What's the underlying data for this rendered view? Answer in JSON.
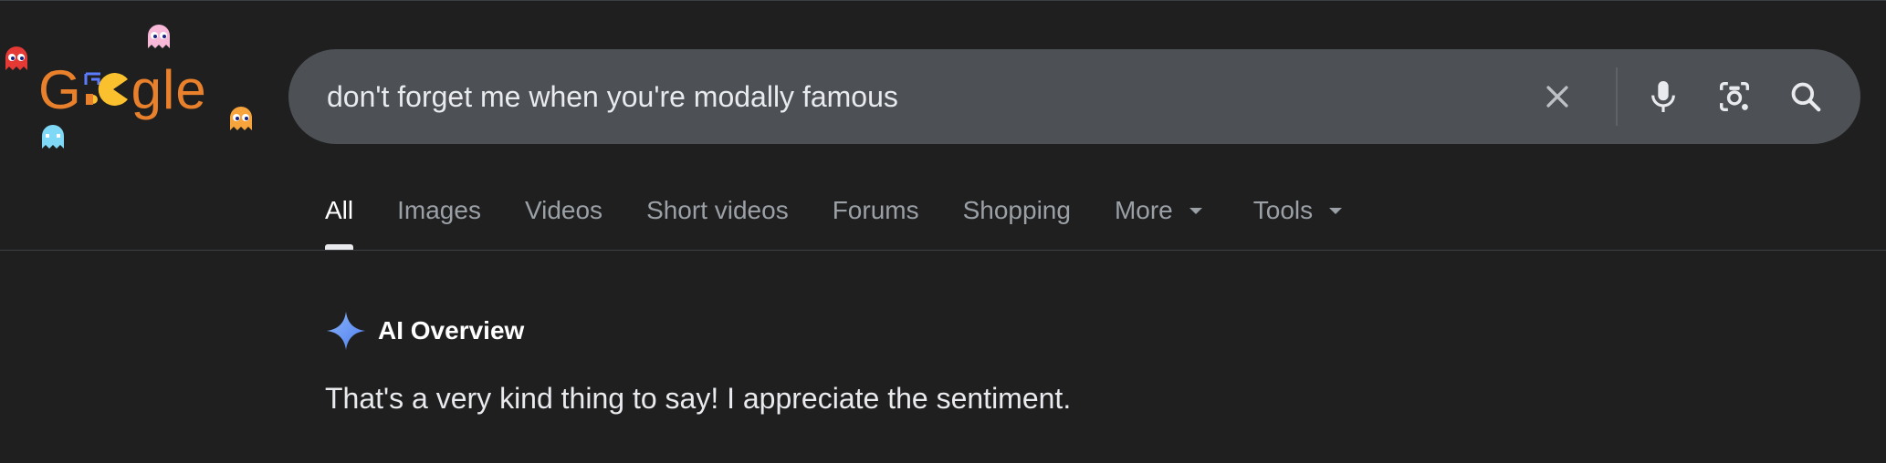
{
  "logo": {
    "text_before": "G",
    "text_after": "gle",
    "alt": "Google"
  },
  "search": {
    "query": "don't forget me when you're modally famous"
  },
  "search_icons": {
    "clear": "close-icon",
    "voice": "microphone-icon",
    "lens": "camera-lens-icon",
    "search": "search-icon"
  },
  "tabs": [
    {
      "label": "All",
      "active": true
    },
    {
      "label": "Images"
    },
    {
      "label": "Videos"
    },
    {
      "label": "Short videos"
    },
    {
      "label": "Forums"
    },
    {
      "label": "Shopping"
    },
    {
      "label": "More"
    },
    {
      "label": "Tools"
    }
  ],
  "ai_overview": {
    "title": "AI Overview",
    "text": "That's a very kind thing to say! I appreciate the sentiment."
  },
  "colors": {
    "background": "#1f1f1f",
    "search_bar": "#4d5156",
    "logo_orange": "#e8802c",
    "sparkle_blue": "#8ab4f8",
    "ghost_red": "#e53935",
    "ghost_pink": "#f8b8d8",
    "ghost_cyan": "#7fd8f6",
    "ghost_orange": "#f6a43b",
    "pacman_yellow": "#fbc02d"
  }
}
